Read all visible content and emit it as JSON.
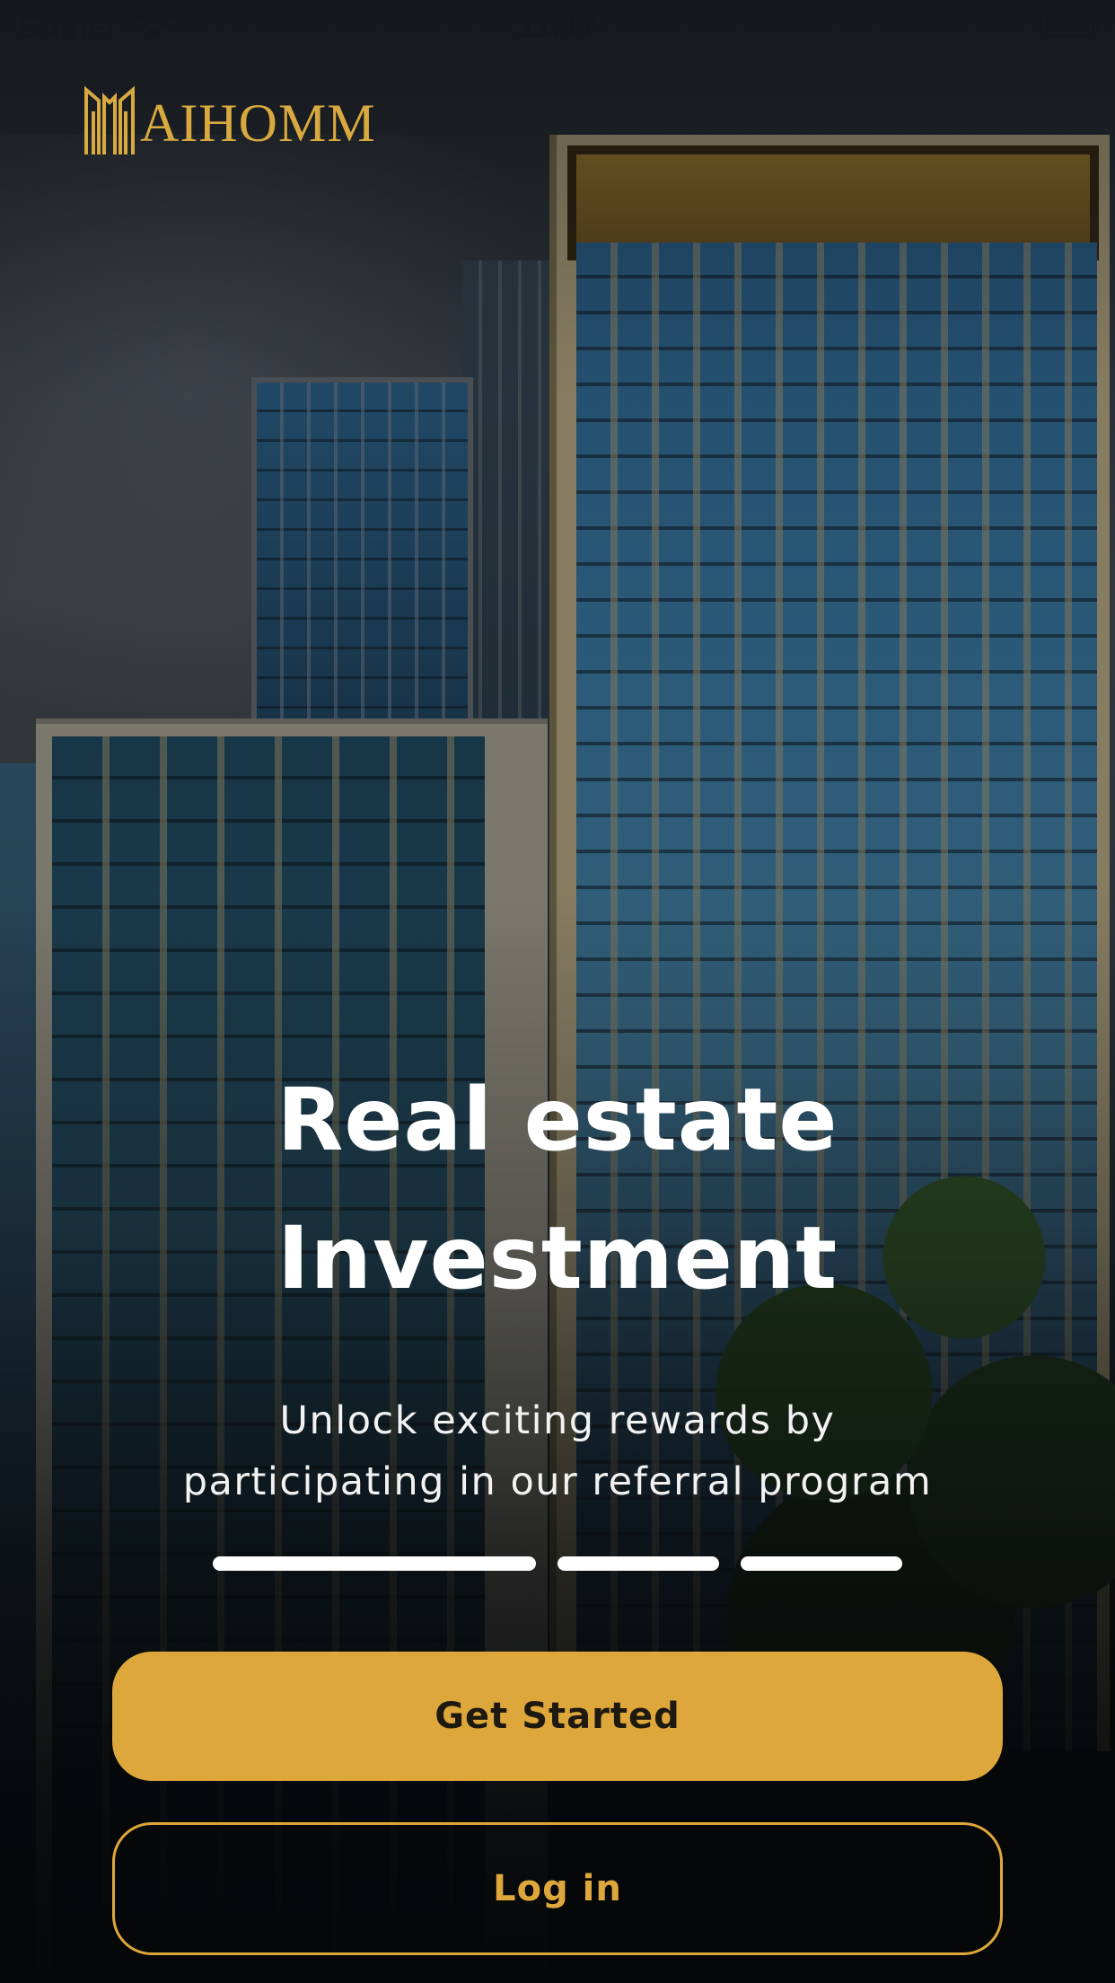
{
  "status_bar": {
    "carrier": "Carrier",
    "time": "11:17",
    "wifi_icon": "wifi-icon",
    "battery_icon": "battery-icon"
  },
  "brand": {
    "name": "AIHOMM",
    "logo_icon": "building-logo-icon",
    "gold": "#dea73b"
  },
  "hero": {
    "title_line1": "Real estate",
    "title_line2": "Investment",
    "subtitle_line1": "Unlock exciting rewards by",
    "subtitle_line2": "participating in our referral program"
  },
  "pager": {
    "pages": 3,
    "active_index": 0
  },
  "actions": {
    "get_started_label": "Get Started",
    "login_label": "Log in"
  }
}
